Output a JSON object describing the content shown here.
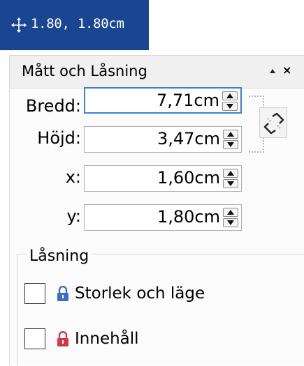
{
  "statusbar": {
    "position_text": "1.80, 1.80cm",
    "icon": "move-arrows-icon"
  },
  "panel": {
    "title": "Mått och Låsning",
    "collapse_icon": "triangle-up-icon",
    "close_label": "×"
  },
  "fields": [
    {
      "label": "Bredd:",
      "value": "7,71cm",
      "focused": true
    },
    {
      "label": "Höjd:",
      "value": "3,47cm",
      "focused": false
    },
    {
      "label": "x:",
      "value": "1,60cm",
      "focused": false
    },
    {
      "label": "y:",
      "value": "1,80cm",
      "focused": false
    }
  ],
  "link_button": {
    "icon": "broken-chain-link-icon"
  },
  "locking": {
    "title": "Låsning",
    "items": [
      {
        "label": "Storlek och läge",
        "checked": false,
        "lock_color": "#3b6fc4",
        "icon": "lock-blue-icon"
      },
      {
        "label": "Innehåll",
        "checked": false,
        "lock_color": "#d03a4c",
        "icon": "lock-red-icon"
      }
    ]
  },
  "colors": {
    "statusbar_bg": "#1a4591",
    "focus_border": "#3a82d8"
  }
}
